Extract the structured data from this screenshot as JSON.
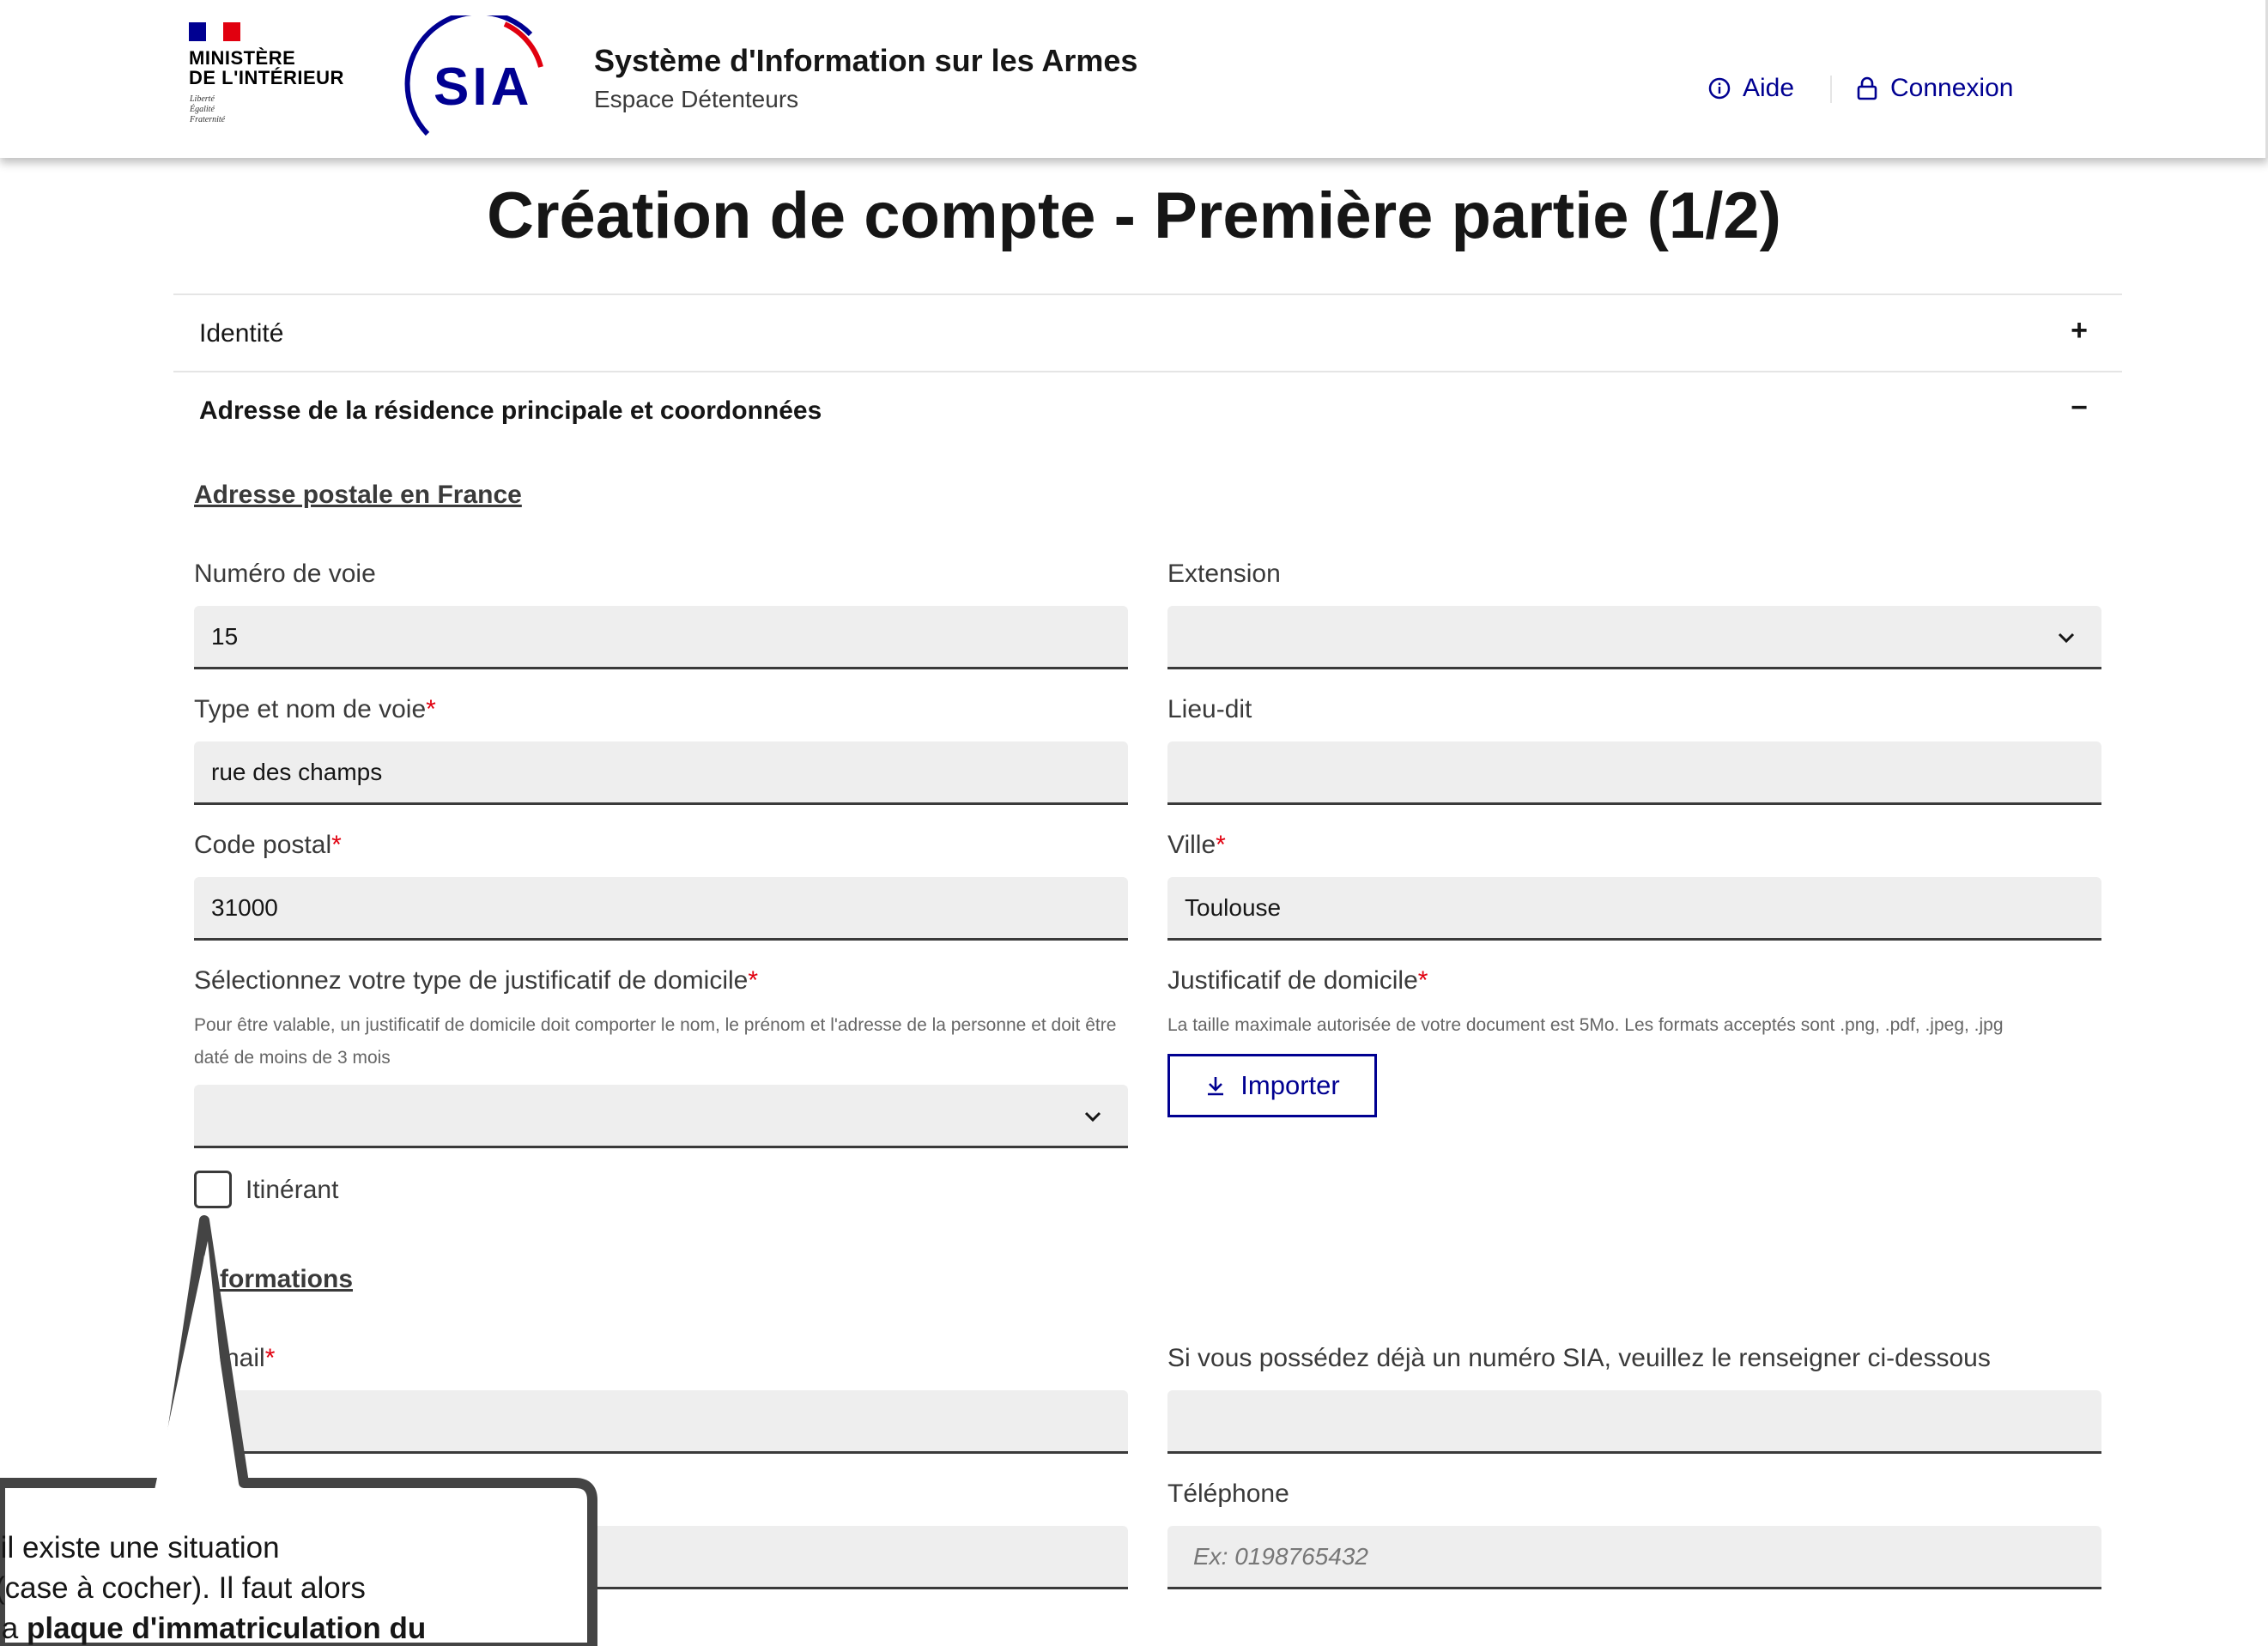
{
  "header": {
    "ministere": "MINISTÈRE\nDE L'INTÉRIEUR",
    "devise": "Liberté\nÉgalité\nFraternité",
    "logo_text": "SIA",
    "app_title": "Système d'Information sur les Armes",
    "app_subtitle": "Espace Détenteurs",
    "nav": {
      "aide": "Aide",
      "connexion": "Connexion"
    }
  },
  "page_title": "Création de compte - Première partie (1/2)",
  "accordion": {
    "identite": {
      "label": "Identité",
      "sign": "+"
    },
    "adresse": {
      "label": "Adresse de la résidence principale et coordonnées",
      "sign": "−"
    }
  },
  "address": {
    "section_title": "Adresse postale en France",
    "numero_voie": {
      "label": "Numéro de voie",
      "value": "15"
    },
    "extension": {
      "label": "Extension",
      "value": ""
    },
    "type_nom_voie": {
      "label": "Type et nom de voie",
      "value": "rue des champs"
    },
    "lieu_dit": {
      "label": "Lieu-dit",
      "value": ""
    },
    "code_postal": {
      "label": "Code postal",
      "value": "31000"
    },
    "ville": {
      "label": "Ville",
      "value": "Toulouse"
    },
    "type_justificatif": {
      "label": "Sélectionnez votre type de justificatif de domicile",
      "hint": "Pour être valable, un justificatif de domicile doit comporter le nom, le prénom et l'adresse de la personne et doit être daté de moins de 3 mois",
      "value": ""
    },
    "justificatif": {
      "label": "Justificatif de domicile",
      "hint": "La taille maximale autorisée de votre document est 5Mo. Les formats acceptés sont .png, .pdf, .jpeg, .jpg",
      "button": "Importer"
    },
    "itinerant": {
      "label": "Itinérant",
      "checked": false
    }
  },
  "contact": {
    "section_title": "formations",
    "email": {
      "label": "nail",
      "value": ""
    },
    "numero_sia": {
      "label": "Si vous possédez déjà un numéro SIA, veuillez le renseigner ci-dessous",
      "value": ""
    },
    "telephone": {
      "label": "Téléphone",
      "placeholder": "Ex: 0198765432",
      "value": ""
    },
    "other_value": ""
  },
  "callout": {
    "line1": "'il existe une situation",
    "line2": "(case à cocher). Il faut alors",
    "line3_prefix": "la ",
    "line3_bold": "plaque d'immatriculation du"
  },
  "colors": {
    "accent": "#000091",
    "required": "#e1000f",
    "field_bg": "#eeeeee"
  }
}
